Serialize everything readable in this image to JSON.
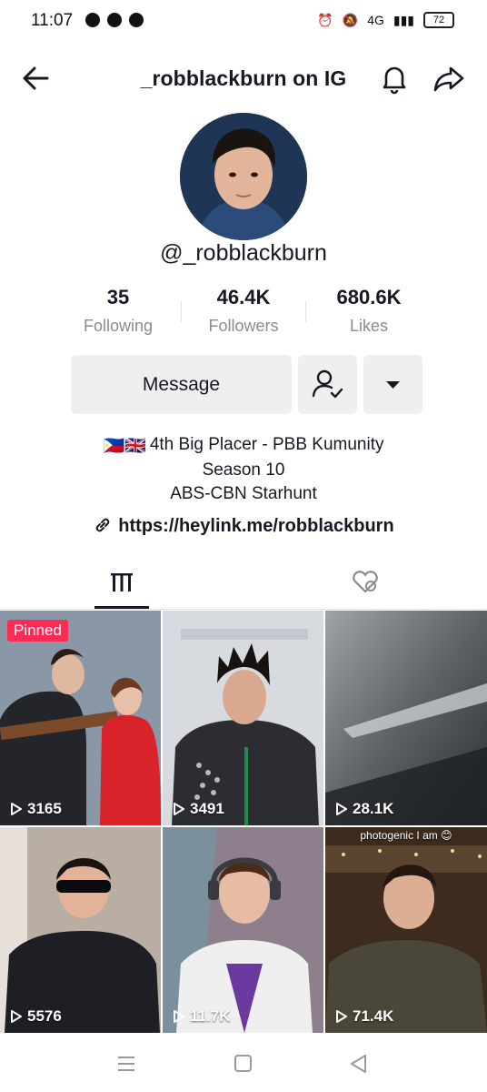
{
  "status": {
    "time": "11:07",
    "battery": "72",
    "network": "4G"
  },
  "header": {
    "title": "_robblackburn on IG"
  },
  "profile": {
    "username": "@_robblackburn"
  },
  "stats": [
    {
      "value": "35",
      "label": "Following"
    },
    {
      "value": "46.4K",
      "label": "Followers"
    },
    {
      "value": "680.6K",
      "label": "Likes"
    }
  ],
  "actions": {
    "message_label": "Message"
  },
  "bio": {
    "flags": "🇵🇭🇬🇧",
    "line1": "4th Big Placer - PBB Kumunity",
    "line2": "Season 10",
    "line3": "ABS-CBN Starhunt",
    "link": "https://heylink.me/robblackburn"
  },
  "videos": [
    {
      "views": "3165",
      "pinned_label": "Pinned"
    },
    {
      "views": "3491"
    },
    {
      "views": "28.1K"
    },
    {
      "views": "5576"
    },
    {
      "views": "11.7K"
    },
    {
      "views": "71.4K",
      "caption": "photogenic I am 😊"
    }
  ],
  "colors": {
    "accent": "#fe2c55",
    "text": "#161823",
    "muted": "#8a8b91",
    "button_bg": "#efefef"
  }
}
